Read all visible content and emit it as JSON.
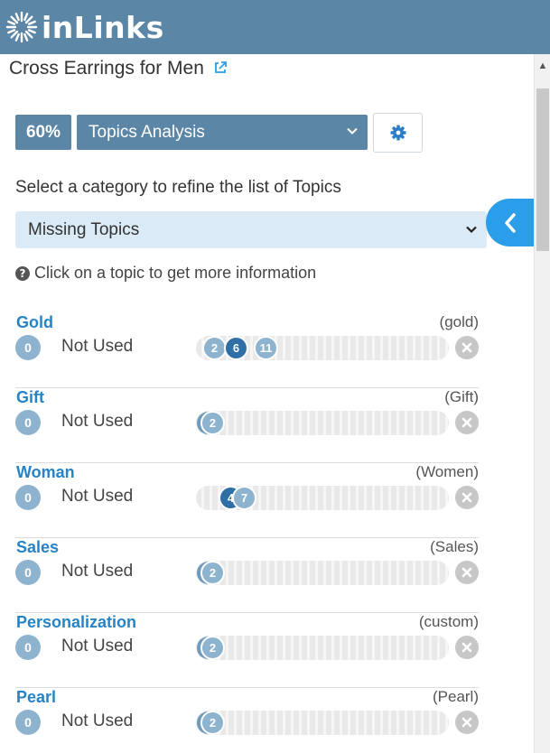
{
  "header": {
    "logo_text": "inLinks",
    "logo_icon": "sunburst-logo-icon",
    "color": "#5b86a6"
  },
  "page": {
    "title": "Cross Earrings for Men",
    "title_icon": "external-link-icon"
  },
  "toolbar": {
    "score": "60%",
    "analysis_select": "Topics Analysis",
    "settings_icon": "gear-icon"
  },
  "filter": {
    "instruction": "Select a category to refine the list of Topics",
    "category_select": "Missing Topics",
    "hint": "Click on a topic to get more information"
  },
  "accent": "#2a9ee8",
  "topics": [
    {
      "name": "Gold",
      "alias": "(gold)",
      "count": "0",
      "status": "Not Used",
      "dots": [
        "2",
        "6",
        "11"
      ]
    },
    {
      "name": "Gift",
      "alias": "(Gift)",
      "count": "0",
      "status": "Not Used",
      "dots": [
        "2"
      ]
    },
    {
      "name": "Woman",
      "alias": "(Women)",
      "count": "0",
      "status": "Not Used",
      "dots": [
        "4",
        "7"
      ]
    },
    {
      "name": "Sales",
      "alias": "(Sales)",
      "count": "0",
      "status": "Not Used",
      "dots": [
        "2"
      ]
    },
    {
      "name": "Personalization",
      "alias": "(custom)",
      "count": "0",
      "status": "Not Used",
      "dots": [
        "2"
      ]
    },
    {
      "name": "Pearl",
      "alias": "(Pearl)",
      "count": "0",
      "status": "Not Used",
      "dots": [
        "2"
      ]
    }
  ]
}
